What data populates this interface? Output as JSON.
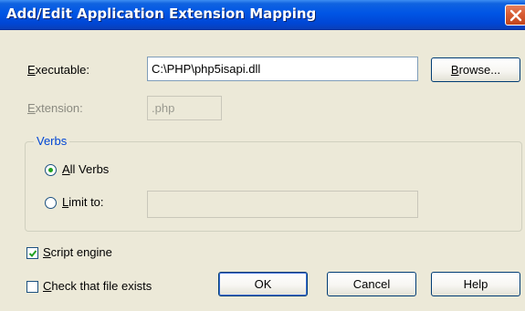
{
  "window": {
    "title": "Add/Edit Application Extension Mapping",
    "close_icon": "close-x"
  },
  "executable": {
    "label_pre": "",
    "label_mnemonic": "E",
    "label_post": "xecutable:",
    "value": "C:\\PHP\\php5isapi.dll"
  },
  "browse_button": {
    "mnemonic": "B",
    "rest": "rowse..."
  },
  "extension": {
    "label_pre": "",
    "label_mnemonic": "E",
    "label_post": "xtension:",
    "value": ".php"
  },
  "verbs": {
    "legend": "Verbs",
    "all_verbs": {
      "mnemonic": "A",
      "rest": "ll Verbs",
      "selected": true
    },
    "limit_to": {
      "mnemonic": "L",
      "rest": "imit to:",
      "selected": false,
      "value": ""
    }
  },
  "script_engine": {
    "pre": "",
    "mnemonic": "S",
    "post": "cript engine",
    "checked": true
  },
  "check_file_exists": {
    "pre": "",
    "mnemonic": "C",
    "post": "heck that file exists",
    "checked": false
  },
  "buttons": {
    "ok": "OK",
    "cancel": "Cancel",
    "help": "Help"
  },
  "colors": {
    "titlebar": "#0055e5",
    "dialog_bg": "#ece9d8",
    "group_legend": "#0046d5",
    "radio_dot": "#21a121",
    "check_mark": "#21a121"
  }
}
